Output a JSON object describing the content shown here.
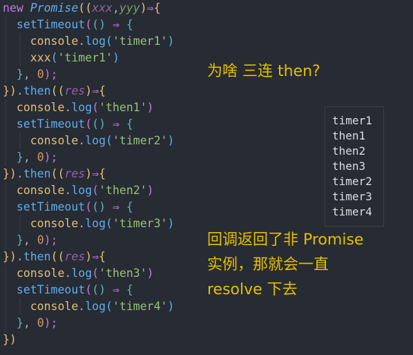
{
  "code": {
    "lines": [
      [
        "new",
        "Promise",
        "((",
        "xxx",
        ",",
        "yyy",
        ")",
        "⇒",
        "{"
      ],
      [
        "setTimeout",
        "(",
        "()",
        "⇒",
        "{"
      ],
      [
        "console",
        ".",
        "log",
        "(",
        "'timer1'",
        ")"
      ],
      [
        "xxx",
        "(",
        "'timer1'",
        ")"
      ],
      [
        "}",
        ",",
        "0",
        ");"
      ],
      [
        "})",
        ".",
        "then",
        "((",
        "res",
        ")",
        "⇒",
        "{"
      ],
      [
        "console",
        ".",
        "log",
        "(",
        "'then1'",
        ")"
      ],
      [
        "setTimeout",
        "(",
        "()",
        "⇒",
        "{"
      ],
      [
        "console",
        ".",
        "log",
        "(",
        "'timer2'",
        ")"
      ],
      [
        "}",
        ",",
        "0",
        ");"
      ],
      [
        "})",
        ".",
        "then",
        "((",
        "res",
        ")",
        "⇒",
        "{"
      ],
      [
        "console",
        ".",
        "log",
        "(",
        "'then2'",
        ")"
      ],
      [
        "setTimeout",
        "(",
        "()",
        "⇒",
        "{"
      ],
      [
        "console",
        ".",
        "log",
        "(",
        "'timer3'",
        ")"
      ],
      [
        "}",
        ",",
        "0",
        ");"
      ],
      [
        "})",
        ".",
        "then",
        "((",
        "res",
        ")",
        "⇒",
        "{"
      ],
      [
        "console",
        ".",
        "log",
        "(",
        "'then3'",
        ")"
      ],
      [
        "setTimeout",
        "(",
        "()",
        "⇒",
        "{"
      ],
      [
        "console",
        ".",
        "log",
        "(",
        "'timer4'",
        ")"
      ],
      [
        "}",
        ",",
        "0",
        ");"
      ],
      [
        "})"
      ]
    ]
  },
  "annotations": {
    "question": "为啥 三连 then?",
    "explanation_line1": "回调返回了非 Promise",
    "explanation_line2": "实例，那就会一直",
    "explanation_line3": "resolve 下去"
  },
  "console_output": [
    "timer1",
    "then1",
    "then2",
    "then3",
    "timer2",
    "timer3",
    "timer4"
  ],
  "colors": {
    "background": "#272b33",
    "annotation": "#e5c000",
    "keyword": "#c678dd",
    "string": "#98c379",
    "number": "#d19a66",
    "function": "#61afef",
    "object": "#e5c07b"
  }
}
